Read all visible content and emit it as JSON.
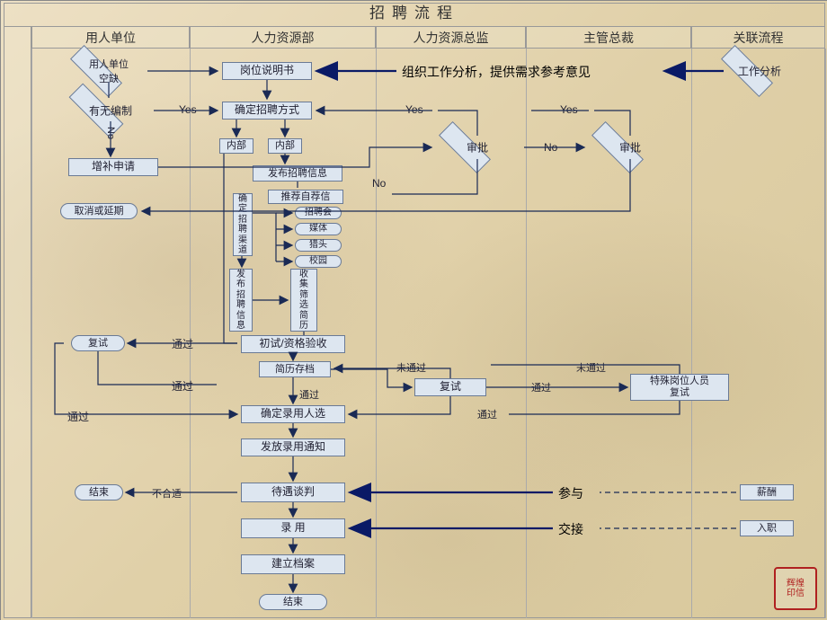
{
  "title": "招聘流程",
  "lanes": {
    "l1": "用人单位",
    "l2": "人力资源部",
    "l3": "人力资源总监",
    "l4": "主管总裁",
    "l5": "关联流程"
  },
  "nodes": {
    "vacancy": "用人单位\n空缺",
    "jobdesc": "岗位说明书",
    "ana_txt": "组织工作分析，提供需求参考意见",
    "workana": "工作分析",
    "hasquota": "有无编制",
    "method": "确定招聘方式",
    "yes1": "Yes",
    "yes2": "Yes",
    "yes3": "Yes",
    "no1": "No",
    "no2": "No",
    "no_rot": "No",
    "internal1": "内部",
    "internal2": "内部",
    "approve1": "审批",
    "approve2": "审批",
    "supplement": "增补申请",
    "publish": "发布招聘信息",
    "recommend": "推荐自荐信",
    "cancel": "取消或延期",
    "channel": "确\n定\n招\n聘\n渠\n道",
    "fair": "招聘会",
    "media": "媒体",
    "headh": "猎头",
    "campus": "校园",
    "pub2": "发\n布\n招\n聘\n信\n息",
    "collect": "收\n集\n筛\n选\n简\n历",
    "retest1": "复试",
    "pass1": "通过",
    "initial": "初试/资格验收",
    "archive": "简历存档",
    "notpass1": "未通过",
    "notpass2": "未通过",
    "pass2": "通过",
    "retest2": "复试",
    "pass_m": "通过",
    "special": "特殊岗位人员\n复试",
    "pass3": "通过",
    "pass4": "通过",
    "decide": "确定录用人选",
    "notice": "发放录用通知",
    "end1": "结束",
    "notfit": "不合适",
    "negotiate": "待遇谈判",
    "participate": "参与",
    "salary": "薪酬",
    "hire": "录    用",
    "handover": "交接",
    "onboard": "入职",
    "filebuild": "建立档案",
    "end2": "结束"
  },
  "seal": "辉煌\n印信"
}
